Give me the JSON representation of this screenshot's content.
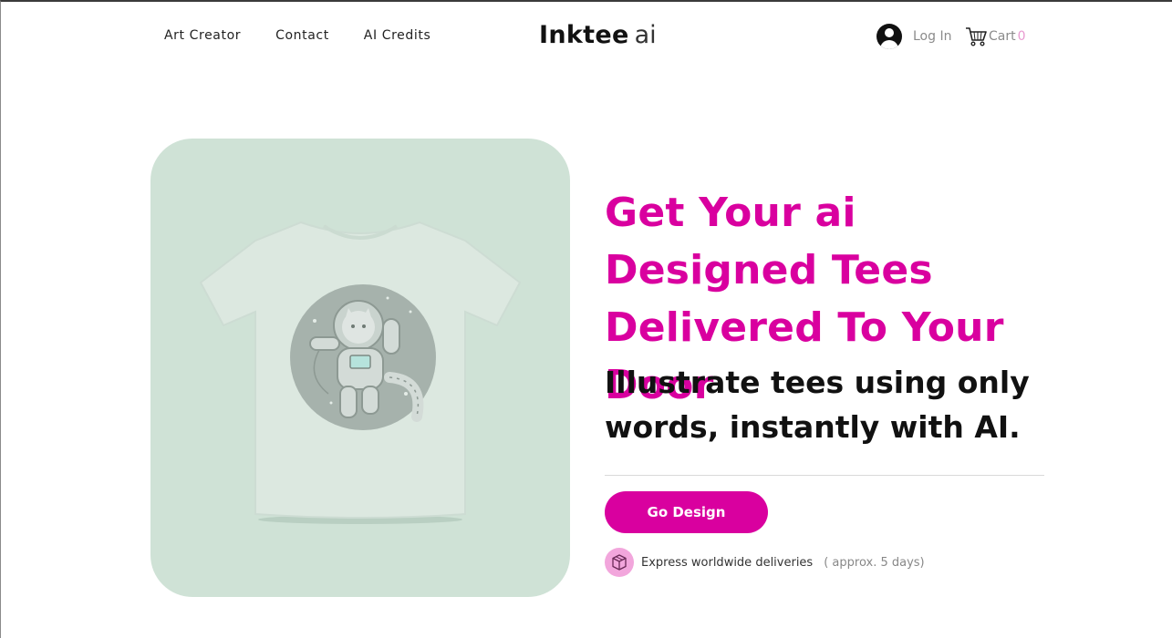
{
  "header": {
    "nav": [
      {
        "label": "Art Creator"
      },
      {
        "label": "Contact"
      },
      {
        "label": "AI Credits"
      }
    ],
    "logo": {
      "brand": "Inktee",
      "suffix": "ai"
    },
    "login_label": "Log In",
    "cart_label": "Cart",
    "cart_count": "0"
  },
  "hero": {
    "headline": "Get Your ai Designed Tees Delivered To Your Door",
    "subheadline": "Illustrate tees using only words, instantly with AI.",
    "cta_label": "Go Design",
    "delivery_text": "Express worldwide deliveries",
    "delivery_note": "( approx. 5 days)"
  },
  "colors": {
    "accent": "#d9009f",
    "card_background": "#cfe2d6",
    "badge": "#f2a6dc"
  },
  "icons": {
    "account": "user-avatar-icon",
    "cart": "shopping-cart-icon",
    "delivery": "package-box-icon"
  }
}
